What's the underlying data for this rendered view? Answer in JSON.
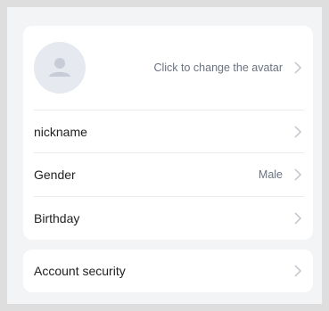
{
  "profile": {
    "avatar_hint": "Click to change the avatar",
    "nickname_label": "nickname",
    "gender_label": "Gender",
    "gender_value": "Male",
    "birthday_label": "Birthday"
  },
  "security": {
    "label": "Account security"
  },
  "icons": {
    "avatar": "user-icon",
    "chevron": "chevron-right-icon"
  },
  "colors": {
    "page_background": "#f3f4f6",
    "card_background": "#ffffff",
    "avatar_background": "#e6e9ef",
    "muted_text": "#6b7280",
    "chevron": "#c0c4cc"
  }
}
